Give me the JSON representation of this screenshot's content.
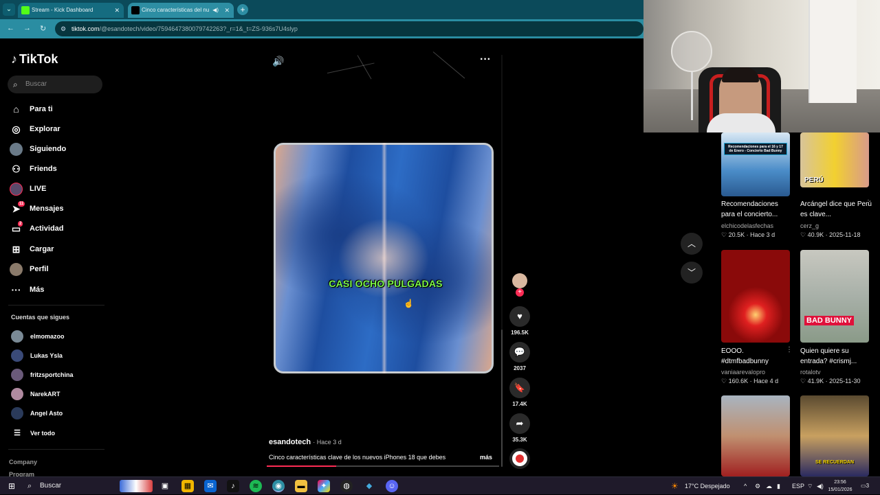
{
  "browser": {
    "tabs": [
      {
        "title": "Stream - Kick Dashboard",
        "active": false
      },
      {
        "title": "Cinco características del nu",
        "active": true
      }
    ],
    "url_host": "tiktok.com",
    "url_path": "/@esandotech/video/7594647380079742263?_r=1&_t=ZS-936s7U4slyp"
  },
  "sidebar": {
    "logo": "TikTok",
    "search_placeholder": "Buscar",
    "menu": [
      {
        "label": "Para ti",
        "icon": "home-icon"
      },
      {
        "label": "Explorar",
        "icon": "compass-icon"
      },
      {
        "label": "Siguiendo",
        "icon": "following-avatar-icon"
      },
      {
        "label": "Friends",
        "icon": "friends-icon"
      },
      {
        "label": "LIVE",
        "icon": "live-icon"
      },
      {
        "label": "Mensajes",
        "icon": "messages-icon",
        "badge": "11"
      },
      {
        "label": "Actividad",
        "icon": "activity-icon",
        "badge": "2"
      },
      {
        "label": "Cargar",
        "icon": "upload-icon"
      },
      {
        "label": "Perfil",
        "icon": "profile-icon"
      },
      {
        "label": "Más",
        "icon": "more-dots-icon"
      }
    ],
    "following_title": "Cuentas que sigues",
    "following": [
      "elmomazoo",
      "Lukas Ysla",
      "fritzsportchina",
      "NarekART",
      "Angel Asto"
    ],
    "see_all": "Ver todo",
    "footer": [
      "Company",
      "Program"
    ]
  },
  "video": {
    "overlay_text": "CASI OCHO PULGADAS",
    "author": "esandotech",
    "time_ago": "· Hace 3 d",
    "description": "Cinco características clave de los nuevos iPhones 18 que debes",
    "more": "más",
    "progress": 0.3
  },
  "actions": {
    "likes": "196.5K",
    "comments": "2037",
    "saves": "17.4K",
    "shares": "35.3K"
  },
  "grid": [
    {
      "title": "Recomendaciones para el concierto...",
      "user": "elchicodelasfechas",
      "likes": "20.5K",
      "date": "Hace 3 d",
      "thumb_text": "Recomendaciones para el 16 y 17 de Enero - Concierto Bad Bunny"
    },
    {
      "title": "Arcángel dice que Perú es clave...",
      "user": "cerz_g",
      "likes": "40.9K",
      "date": "2025-11-18",
      "thumb_text": "PERÚ"
    },
    {
      "title": "EOOO. #dtmfbadbunny",
      "user": "vaniaarevalopro",
      "likes": "160.6K",
      "date": "Hace 4 d",
      "thumb_text": ""
    },
    {
      "title": "Quien quiere su entrada? #crismj...",
      "user": "rotalotv",
      "likes": "41.9K",
      "date": "2025-11-30",
      "thumb_text": "BAD BUNNY"
    },
    {
      "title": "",
      "user": "",
      "likes": "",
      "date": "",
      "thumb_text": ""
    },
    {
      "title": "",
      "user": "",
      "likes": "",
      "date": "",
      "thumb_text": "SE RECUERDAN"
    }
  ],
  "taskbar": {
    "search": "Buscar",
    "weather": "17°C  Despejado",
    "lang": "ESP",
    "time": "23:56",
    "date": "15/01/2026",
    "notif": "3"
  }
}
